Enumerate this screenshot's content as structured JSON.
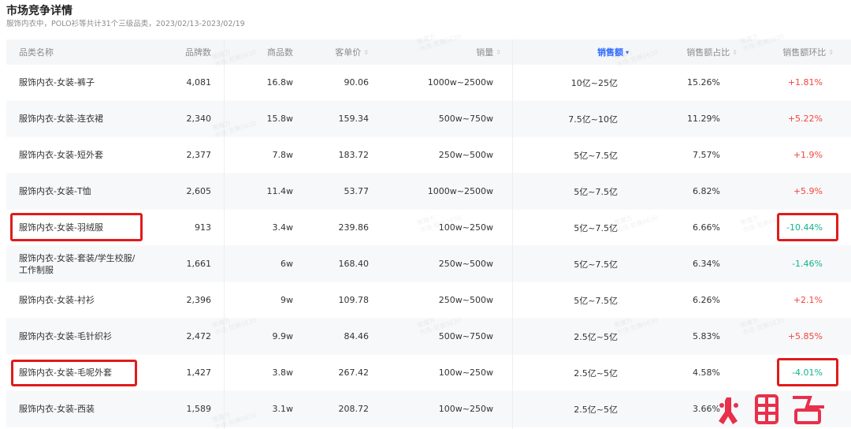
{
  "header": {
    "title": "市场竞争详情",
    "subtitle": "服饰内衣中，POLO衫等共计31个三级品类，2023/02/13-2023/02/19"
  },
  "columns": {
    "name": "品类名称",
    "brand_count": "品牌数",
    "goods_count": "商品数",
    "unit_price": "客单价",
    "volume": "销量",
    "sales": "销售额",
    "share": "销售额占比",
    "change": "销售额环比"
  },
  "sort_icon": "sort-updown-icon",
  "rows": [
    {
      "name": "服饰内衣-女装-裤子",
      "brand_count": "4,081",
      "goods_count": "16.8w",
      "unit_price": "90.06",
      "volume": "1000w~2500w",
      "sales": "10亿~25亿",
      "share": "15.26%",
      "change": "+1.81%",
      "trend": "up"
    },
    {
      "name": "服饰内衣-女装-连衣裙",
      "brand_count": "2,340",
      "goods_count": "15.8w",
      "unit_price": "159.34",
      "volume": "500w~750w",
      "sales": "7.5亿~10亿",
      "share": "11.29%",
      "change": "+5.22%",
      "trend": "up"
    },
    {
      "name": "服饰内衣-女装-短外套",
      "brand_count": "2,377",
      "goods_count": "7.8w",
      "unit_price": "183.72",
      "volume": "250w~500w",
      "sales": "5亿~7.5亿",
      "share": "7.57%",
      "change": "+1.9%",
      "trend": "up"
    },
    {
      "name": "服饰内衣-女装-T恤",
      "brand_count": "2,605",
      "goods_count": "11.4w",
      "unit_price": "53.77",
      "volume": "1000w~2500w",
      "sales": "5亿~7.5亿",
      "share": "6.82%",
      "change": "+5.9%",
      "trend": "up"
    },
    {
      "name": "服饰内衣-女装-羽绒服",
      "brand_count": "913",
      "goods_count": "3.4w",
      "unit_price": "239.86",
      "volume": "100w~250w",
      "sales": "5亿~7.5亿",
      "share": "6.66%",
      "change": "-10.44%",
      "trend": "down"
    },
    {
      "name": "服饰内衣-女装-套装/学生校服/工作制服",
      "brand_count": "1,661",
      "goods_count": "6w",
      "unit_price": "168.40",
      "volume": "250w~500w",
      "sales": "5亿~7.5亿",
      "share": "6.34%",
      "change": "-1.46%",
      "trend": "down"
    },
    {
      "name": "服饰内衣-女装-衬衫",
      "brand_count": "2,396",
      "goods_count": "9w",
      "unit_price": "109.78",
      "volume": "250w~500w",
      "sales": "5亿~7.5亿",
      "share": "6.26%",
      "change": "+2.1%",
      "trend": "up"
    },
    {
      "name": "服饰内衣-女装-毛针织衫",
      "brand_count": "2,472",
      "goods_count": "9.9w",
      "unit_price": "84.46",
      "volume": "500w~750w",
      "sales": "2.5亿~5亿",
      "share": "5.83%",
      "change": "+5.85%",
      "trend": "up"
    },
    {
      "name": "服饰内衣-女装-毛呢外套",
      "brand_count": "1,427",
      "goods_count": "3.8w",
      "unit_price": "267.42",
      "volume": "100w~250w",
      "sales": "2.5亿~5亿",
      "share": "4.58%",
      "change": "-4.01%",
      "trend": "down"
    },
    {
      "name": "服饰内衣-女装-西装",
      "brand_count": "1,589",
      "goods_count": "3.1w",
      "unit_price": "208.72",
      "volume": "100w~250w",
      "sales": "2.5亿~5亿",
      "share": "3.66%",
      "change": "",
      "trend": "up"
    }
  ],
  "watermark": {
    "line1": "策魔方",
    "line2": "市场·竞赛0630"
  },
  "logo": {
    "text": "火鲤鱼",
    "color": "#e8304a"
  },
  "colors": {
    "accent": "#2f6bff",
    "up": "#f5453d",
    "down": "#12b48c",
    "highlight": "#e01b1b"
  }
}
